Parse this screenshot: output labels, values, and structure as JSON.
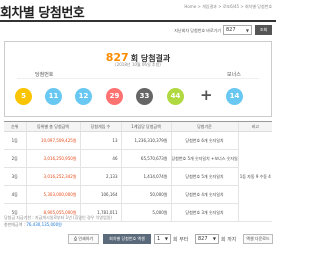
{
  "header": {
    "title": "회차별 당첨번호",
    "breadcrumb": "Home > 게임결과 > 로또6/45 > 회차별 당첨번호"
  },
  "selector": {
    "label": "지난회차 당첨번호 바로가기",
    "value": "827",
    "button": "조회"
  },
  "result": {
    "round": "827",
    "round_suffix": "회 당첨결과",
    "date": "(2018년 10월 06일 추첨)",
    "win_label": "당첨번호",
    "bonus_label": "보너스",
    "numbers": [
      {
        "value": "5",
        "color": "#fbc400"
      },
      {
        "value": "11",
        "color": "#69c8f2"
      },
      {
        "value": "12",
        "color": "#69c8f2"
      },
      {
        "value": "29",
        "color": "#ff7272"
      },
      {
        "value": "33",
        "color": "#666666"
      },
      {
        "value": "44",
        "color": "#b0d840"
      }
    ],
    "plus": "+",
    "bonus": {
      "value": "14",
      "color": "#69c8f2"
    }
  },
  "table": {
    "headers": [
      "순위",
      "등위별 총 당첨금액",
      "당첨게임 수",
      "1게임당 당첨금액",
      "당첨기준",
      "비고"
    ],
    "rows": [
      {
        "rank": "1등",
        "total": "10,097,509,425원",
        "count": "13",
        "per_game": "1,236,310,379원",
        "criteria": "당첨번호 6개 숫자일치"
      },
      {
        "rank": "2등",
        "total": "3,016,250,950원",
        "count": "46",
        "per_game": "65,570,673원",
        "criteria": "당첨번호 5개 숫자일치 +보너스 숫자일치"
      },
      {
        "rank": "3등",
        "total": "3,016,252,342원",
        "count": "2,133",
        "per_game": "1,414,074원",
        "criteria": "당첨번호 5개 숫자일치"
      },
      {
        "rank": "4등",
        "total": "5,303,000,000원",
        "count": "106,164",
        "per_game": "50,000원",
        "criteria": "당첨번호 4개 숫자일치"
      },
      {
        "rank": "5등",
        "total": "8,905,055,000원",
        "count": "1,781,011",
        "per_game": "5,000원",
        "criteria": "당첨번호 3개 숫자일치"
      }
    ],
    "note": "1등 자동 9 수동 4"
  },
  "footnote": {
    "line1": "당첨금 지급기한 : 지급개시일로부터 1년 (휴일인 경우 익영업일)",
    "line2_label": "총판매금액 :",
    "line2_value": "76,430,135,000원"
  },
  "bottom_bar": {
    "print_button": "인쇄하기",
    "stats_button": "회차별 당첨번호 엑셀",
    "from_value": "1",
    "between": "회 부터",
    "to_value": "827",
    "to_suffix": "회 까지",
    "download_button": "엑셀 다운로드"
  }
}
